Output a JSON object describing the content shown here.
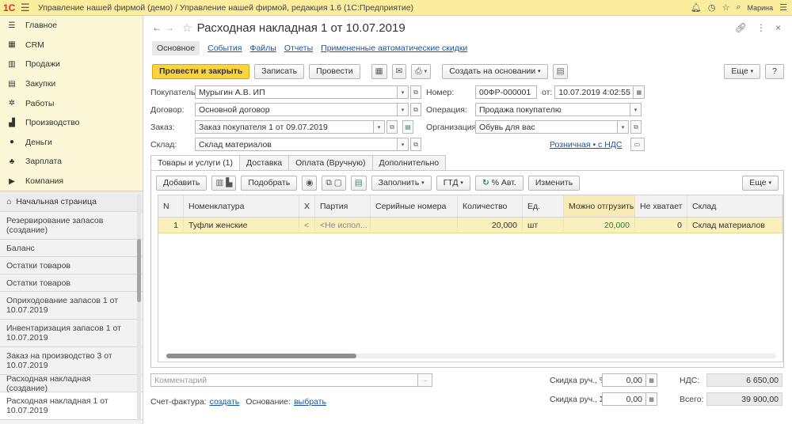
{
  "app": {
    "title": "Управление нашей фирмой (демо) / Управление нашей фирмой, редакция 1.6  (1С:Предприятие)",
    "user": "Марина"
  },
  "sidebar": {
    "sections": [
      {
        "label": "Главное",
        "icon": "menu-icon",
        "glyph": "☰"
      },
      {
        "label": "CRM",
        "icon": "crm-icon",
        "glyph": "▦"
      },
      {
        "label": "Продажи",
        "icon": "sales-icon",
        "glyph": "▥"
      },
      {
        "label": "Закупки",
        "icon": "purchases-icon",
        "glyph": "▤"
      },
      {
        "label": "Работы",
        "icon": "works-icon",
        "glyph": "✲"
      },
      {
        "label": "Производство",
        "icon": "production-icon",
        "glyph": "▟"
      },
      {
        "label": "Деньги",
        "icon": "money-icon",
        "glyph": "●"
      },
      {
        "label": "Зарплата",
        "icon": "salary-icon",
        "glyph": "♣"
      },
      {
        "label": "Компания",
        "icon": "company-icon",
        "glyph": "▶"
      }
    ],
    "home": "Начальная страница",
    "open_windows": [
      "Резервирование запасов (создание)",
      "Баланс",
      "Остатки товаров",
      "Остатки товаров",
      "Оприходование запасов 1 от 10.07.2019",
      "Инвентаризация запасов 1 от 10.07.2019",
      "Заказ на производство 3 от 10.07.2019",
      "Расходная накладная (создание)",
      "Расходная накладная 1 от 10.07.2019"
    ]
  },
  "doc": {
    "title": "Расходная накладная 1 от 10.07.2019",
    "tabs": [
      "Основное",
      "События",
      "Файлы",
      "Отчеты",
      "Примененные автоматические скидки"
    ],
    "toolbar": {
      "post_close": "Провести и закрыть",
      "save": "Записать",
      "post": "Провести",
      "create_based": "Создать на основании",
      "more": "Еще",
      "help": "?"
    },
    "fields": {
      "buyer_label": "Покупатель:",
      "buyer": "Мурыгин А.В. ИП",
      "contract_label": "Договор:",
      "contract": "Основной договор",
      "order_label": "Заказ:",
      "order": "Заказ покупателя 1 от 09.07.2019",
      "warehouse_label": "Склад:",
      "warehouse": "Склад материалов",
      "number_label": "Номер:",
      "number": "00ФР-000001",
      "from_label": "от:",
      "date": "10.07.2019  4:02:55",
      "operation_label": "Операция:",
      "operation": "Продажа покупателю",
      "org_label": "Организация:",
      "org": "Обувь для вас",
      "price_type": "Розничная • с НДС"
    },
    "detail_tabs": [
      "Товары и услуги (1)",
      "Доставка",
      "Оплата (Вручную)",
      "Дополнительно"
    ],
    "table_toolbar": {
      "add": "Добавить",
      "pick": "Подобрать",
      "fill": "Заполнить",
      "gtd": "ГТД",
      "auto_discount": "% Авт.",
      "change": "Изменить",
      "more": "Еще"
    },
    "columns": [
      "N",
      "Номенклатура",
      "Х",
      "Партия",
      "Серийные номера",
      "Количество",
      "Ед.",
      "Можно отгрузить",
      "Не хватает",
      "Склад"
    ],
    "rows": [
      {
        "n": "1",
        "item": "Туфли женские",
        "x": "<",
        "batch": "<Не испол...",
        "serial": "",
        "qty": "20,000",
        "unit": "шт",
        "can_ship": "20,000",
        "shortage": "0",
        "warehouse": "Склад материалов"
      }
    ],
    "footer": {
      "comment_placeholder": "Комментарий",
      "invoice_label": "Счет-фактура:",
      "invoice_link": "создать",
      "basis_label": "Основание:",
      "basis_link": "выбрать",
      "discount_pct_label": "Скидка руч., %:",
      "discount_pct": "0,00",
      "discount_sum_label": "Скидка руч., Σ:",
      "discount_sum": "0,00",
      "vat_label": "НДС:",
      "vat": "6 650,00",
      "total_label": "Всего:",
      "total": "39 900,00"
    }
  }
}
